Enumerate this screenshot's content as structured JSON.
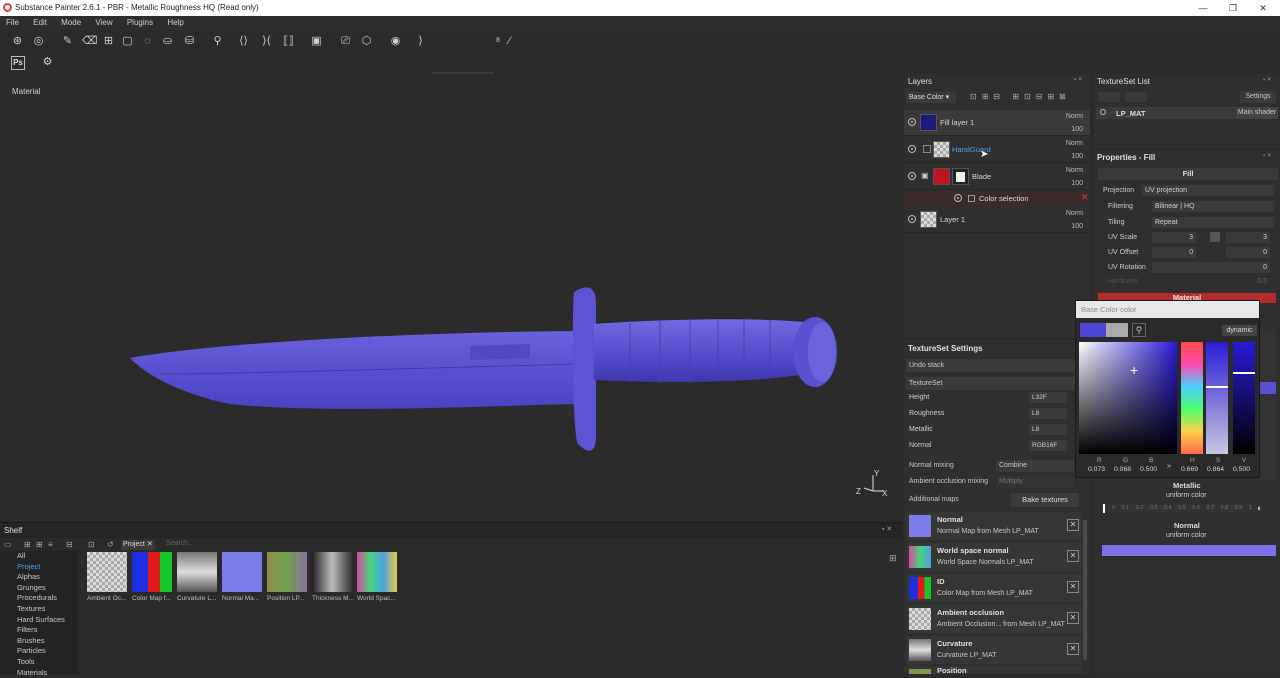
{
  "window": {
    "title": "Substance Painter 2.6.1 - PBR - Metallic Roughness HQ (Read only)"
  },
  "menu": [
    "File",
    "Edit",
    "Mode",
    "View",
    "Plugins",
    "Help"
  ],
  "toolbar": {
    "brush_size": "8",
    "ps_label": "Ps"
  },
  "viewport": {
    "label": "Material",
    "gizmo_y": "Y",
    "gizmo_z": "Z",
    "gizmo_x": "X"
  },
  "shelf": {
    "title": "Shelf",
    "filter_tag": "Project",
    "search_placeholder": "Search...",
    "categories": [
      "All",
      "Project",
      "Alphas",
      "Grunges",
      "Procedurals",
      "Textures",
      "Hard Surfaces",
      "Filters",
      "Brushes",
      "Particles",
      "Tools",
      "Materials"
    ],
    "active_category": "Project",
    "thumbs": [
      "Ambient Oc...",
      "Color Map f...",
      "Curvature L...",
      "Normal Ma...",
      "Position LP...",
      "Thickness M...",
      "World Spac..."
    ]
  },
  "layers": {
    "title": "Layers",
    "channel": "Base Color",
    "items": [
      {
        "name": "Fill layer 1",
        "blend": "Norm",
        "opacity": "100"
      },
      {
        "name": "HandGuard",
        "blend": "Norm",
        "opacity": "100"
      },
      {
        "name": "Blade",
        "blend": "Norm",
        "opacity": "100"
      },
      {
        "name": "Color selection"
      },
      {
        "name": "Layer 1",
        "blend": "Norm",
        "opacity": "100"
      }
    ]
  },
  "texture_set_settings": {
    "title": "TextureSet Settings",
    "undo": "Undo stack",
    "section": "TextureSet",
    "channels": [
      {
        "label": "Height",
        "format": "L32F"
      },
      {
        "label": "Roughness",
        "format": "L8"
      },
      {
        "label": "Metallic",
        "format": "L8"
      },
      {
        "label": "Normal",
        "format": "RGB16F"
      }
    ],
    "normal_mixing_label": "Normal mixing",
    "normal_mixing_value": "Combine",
    "ao_mixing_label": "Ambient occlusion mixing",
    "ao_mixing_value": "Multiply",
    "additional_maps_label": "Additional maps",
    "bake_button": "Bake textures",
    "maps": [
      {
        "title": "Normal",
        "sub": "Normal Map from Mesh LP_MAT"
      },
      {
        "title": "World space normal",
        "sub": "World Space Normals LP_MAT"
      },
      {
        "title": "ID",
        "sub": "Color Map from Mesh LP_MAT"
      },
      {
        "title": "Ambient occlusion",
        "sub": "Ambient Occlusion... from Mesh LP_MAT"
      },
      {
        "title": "Curvature",
        "sub": "Curvature LP_MAT"
      },
      {
        "title": "Position",
        "sub": ""
      }
    ]
  },
  "textureset_list": {
    "title": "TextureSet List",
    "settings_button": "Settings",
    "item": "LP_MAT",
    "shader": "Main shader"
  },
  "properties": {
    "title": "Properties - Fill",
    "fill_label": "Fill",
    "projection_label": "Projection",
    "projection_value": "UV projection",
    "filtering_label": "Filtering",
    "filtering_value": "Bilinear | HQ",
    "tiling_label": "Tiling",
    "tiling_value": "Repeat",
    "uv_scale_label": "UV Scale",
    "uv_scale_a": "3",
    "uv_scale_b": "3",
    "uv_offset_label": "UV Offset",
    "uv_offset_a": "0",
    "uv_offset_b": "0",
    "uv_rotation_label": "UV Rotation",
    "uv_rotation_value": "0",
    "hardness_label": "Hardness",
    "hardness_value": "0.5",
    "material_label": "Material",
    "metallic_title": "Metallic",
    "metallic_sub": "uniform color",
    "normal_title": "Normal",
    "normal_sub": "uniform color",
    "slider_ticks": [
      "0",
      "0.1",
      "0.2",
      "0.3",
      "0.4",
      "0.5",
      "0.6",
      "0.7",
      "0.8",
      "0.9",
      "1"
    ]
  },
  "color_picker": {
    "title": "Base Color color",
    "mode": "dynamic",
    "r_label": "R",
    "g_label": "G",
    "b_label": "B",
    "h_label": "H",
    "s_label": "S",
    "v_label": "V",
    "r": "0.073",
    "g": "0.068",
    "b": "0.500",
    "h": "0.669",
    "s": "0.864",
    "v": "0.500",
    "arrow": ">",
    "current_color": "#4c44d6"
  },
  "colors": {
    "knife": "#5a50d0",
    "accent_blue": "#4aa3df",
    "blade_red": "#c0151e"
  }
}
